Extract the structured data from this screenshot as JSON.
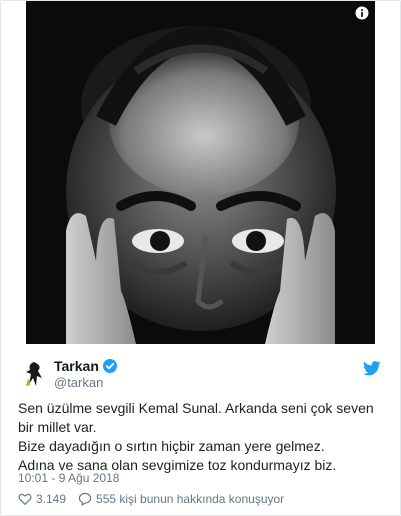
{
  "tweet": {
    "author_name": "Tarkan",
    "author_handle": "@tarkan",
    "text_lines": [
      "Sen üzülme sevgili Kemal Sunal. Arkanda seni çok seven bir millet var.",
      "Bize dayadığın o sırtın hiçbir zaman yere gelmez.",
      "Adına ve sana olan sevgimize toz kondurmayız biz."
    ],
    "timestamp": "10:01 - 9 Ağu 2018",
    "likes": "3.149",
    "conversation": "555 kişi bunun hakkında konuşuyor"
  },
  "icons": {
    "info": "info-icon",
    "verified": "verified-badge-icon",
    "twitter": "twitter-bird-icon",
    "like": "heart-icon",
    "reply": "speech-bubble-icon"
  },
  "colors": {
    "twitter_blue": "#1da1f2",
    "text": "#1c2022",
    "muted": "#657786"
  }
}
